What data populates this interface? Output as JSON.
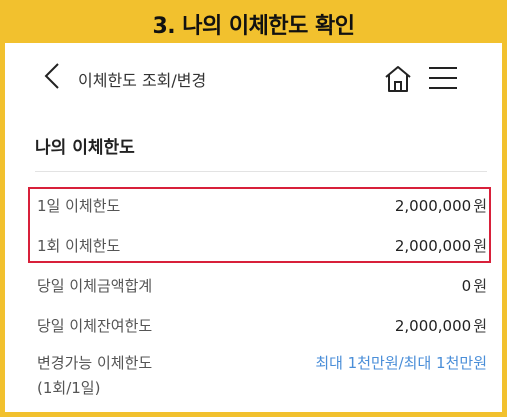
{
  "banner": {
    "title": "3. 나의 이체한도 확인"
  },
  "header": {
    "back_icon": "chevron-left",
    "title": "이체한도 조회/변경",
    "home_icon": "home",
    "menu_icon": "hamburger-menu"
  },
  "section": {
    "title": "나의 이체한도"
  },
  "rows": [
    {
      "label": "1일 이체한도",
      "value": "2,000,000",
      "unit": "원"
    },
    {
      "label": "1회 이체한도",
      "value": "2,000,000",
      "unit": "원"
    },
    {
      "label": "당일 이체금액합계",
      "value": "0",
      "unit": "원"
    },
    {
      "label": "당일 이체잔여한도",
      "value": "2,000,000",
      "unit": "원"
    }
  ],
  "change_limit": {
    "label": "변경가능 이체한도",
    "label_sub": "(1회/1일)",
    "value": "최대 1천만원/최대 1천만원"
  },
  "colors": {
    "banner": "#f2c12e",
    "highlight_border": "#d8203a",
    "link": "#4a8ed8"
  }
}
